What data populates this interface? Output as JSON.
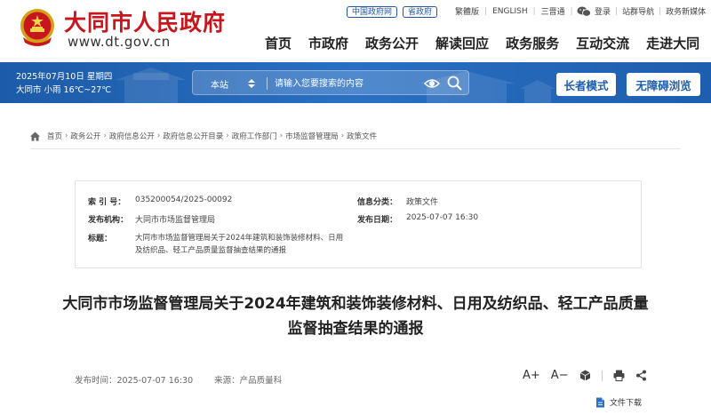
{
  "header": {
    "title": "大同市人民政府",
    "url": "www.dt.gov.cn",
    "tags": [
      "中国政府网",
      "省政府"
    ],
    "lang_links": [
      "繁體版",
      "ENGLISH",
      "三晋通"
    ],
    "right_links": [
      "登录",
      "站群导航",
      "政务新媒体"
    ],
    "nav": [
      "首页",
      "市政府",
      "政务公开",
      "解读回应",
      "政务服务",
      "互动交流",
      "走进大同"
    ]
  },
  "banner": {
    "date": "2025年07月10日 星期四",
    "weather": "大同市 小雨 16℃~27℃",
    "search_scope": "本站",
    "search_placeholder": "请输入您要搜索的内容",
    "elder_mode": "长者模式",
    "accessible": "无障碍浏览"
  },
  "breadcrumb": [
    "首页",
    "政务公开",
    "政府信息公开",
    "政府信息公开目录",
    "政府工作部门",
    "市场监督管理局",
    "政策文件"
  ],
  "info": {
    "index_label": "索 引 号：",
    "index_value": "035200054/2025-00092",
    "category_label": "信息分类：",
    "category_value": "政策文件",
    "org_label": "发布机构：",
    "org_value": "大同市市场监督管理局",
    "date_label": "发布日期：",
    "date_value": "2025-07-07 16:30",
    "title_label": "标题：",
    "title_value": "大同市市场监督管理局关于2024年建筑和装饰装修材料、日用及纺织品、轻工产品质量监督抽查结果的通报"
  },
  "article": {
    "title_line1": "大同市市场监督管理局关于2024年建筑和装饰装修材料、日用及纺织品、轻工产品质量",
    "title_line2": "监督抽查结果的通报",
    "publish_time": "发布时间：2025-07-07 16:30",
    "source": "来源：产品质量科",
    "font_up": "A+",
    "font_down": "A−",
    "download": "文件下载"
  },
  "colors": {
    "brand_red": "#c8161d",
    "banner_blue": "#1c5ba8",
    "link_blue": "#2256a8"
  }
}
